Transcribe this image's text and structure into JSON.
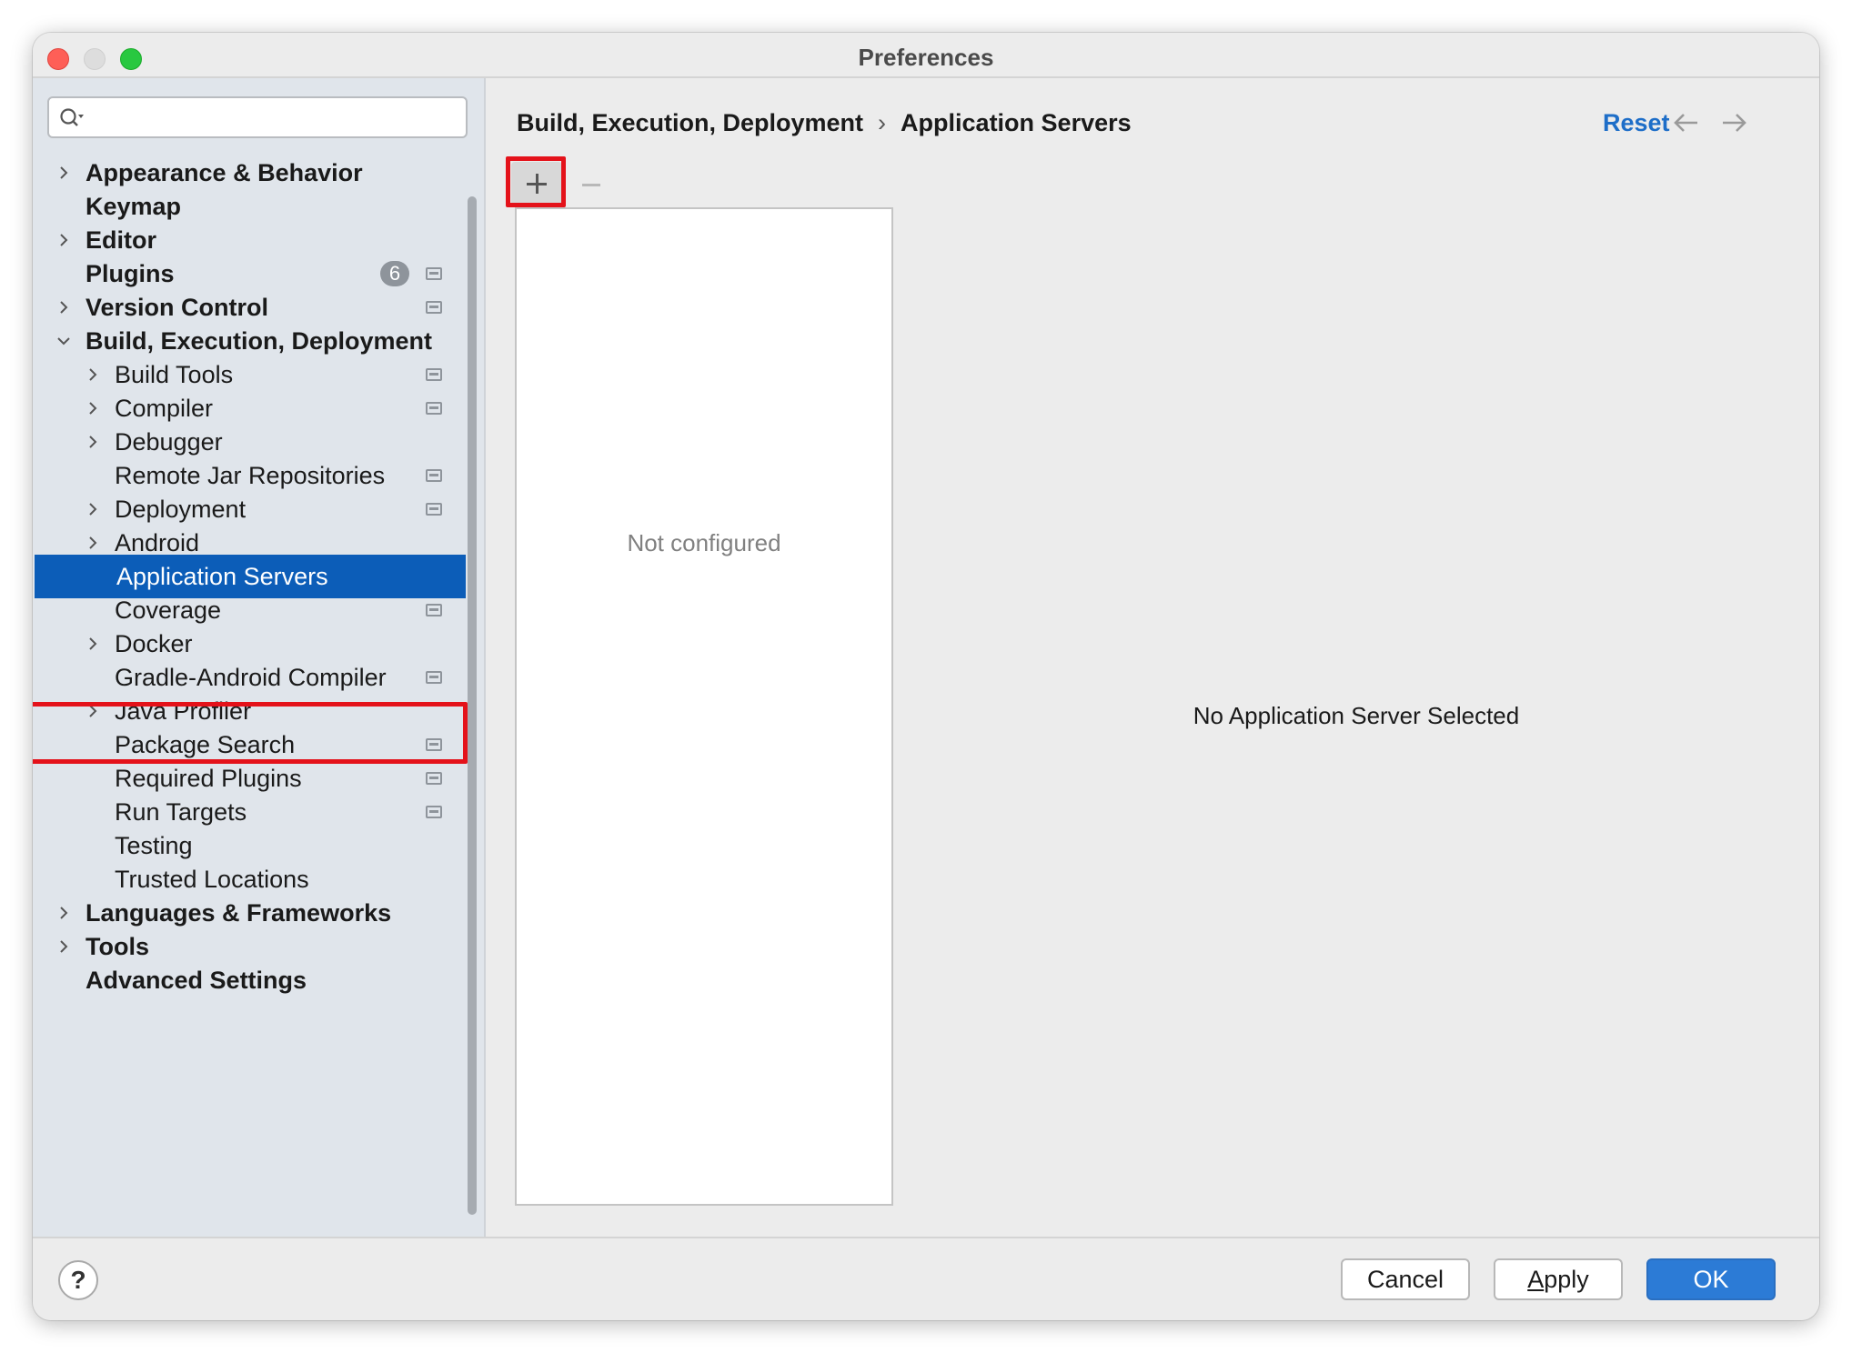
{
  "window": {
    "title": "Preferences"
  },
  "search": {
    "placeholder": "",
    "value": ""
  },
  "sidebar": {
    "items": [
      {
        "label": "Appearance & Behavior",
        "level": 0,
        "expandable": true,
        "expanded": false,
        "project_icon": false
      },
      {
        "label": "Keymap",
        "level": 0,
        "expandable": false,
        "project_icon": false
      },
      {
        "label": "Editor",
        "level": 0,
        "expandable": true,
        "expanded": false,
        "project_icon": false
      },
      {
        "label": "Plugins",
        "level": 0,
        "expandable": false,
        "badge": "6",
        "project_icon": true
      },
      {
        "label": "Version Control",
        "level": 0,
        "expandable": true,
        "expanded": false,
        "project_icon": true
      },
      {
        "label": "Build, Execution, Deployment",
        "level": 0,
        "expandable": true,
        "expanded": true,
        "project_icon": false
      },
      {
        "label": "Build Tools",
        "level": 1,
        "expandable": true,
        "expanded": false,
        "project_icon": true
      },
      {
        "label": "Compiler",
        "level": 1,
        "expandable": true,
        "expanded": false,
        "project_icon": true
      },
      {
        "label": "Debugger",
        "level": 1,
        "expandable": true,
        "expanded": false,
        "project_icon": false
      },
      {
        "label": "Remote Jar Repositories",
        "level": 1,
        "expandable": false,
        "project_icon": true
      },
      {
        "label": "Deployment",
        "level": 1,
        "expandable": true,
        "expanded": false,
        "project_icon": true
      },
      {
        "label": "Android",
        "level": 1,
        "expandable": true,
        "expanded": false,
        "project_icon": false
      },
      {
        "label": "Application Servers",
        "level": 1,
        "expandable": false,
        "selected": true,
        "project_icon": false
      },
      {
        "label": "Coverage",
        "level": 1,
        "expandable": false,
        "project_icon": true
      },
      {
        "label": "Docker",
        "level": 1,
        "expandable": true,
        "expanded": false,
        "project_icon": false
      },
      {
        "label": "Gradle-Android Compiler",
        "level": 1,
        "expandable": false,
        "project_icon": true
      },
      {
        "label": "Java Profiler",
        "level": 1,
        "expandable": true,
        "expanded": false,
        "project_icon": false
      },
      {
        "label": "Package Search",
        "level": 1,
        "expandable": false,
        "project_icon": true
      },
      {
        "label": "Required Plugins",
        "level": 1,
        "expandable": false,
        "project_icon": true
      },
      {
        "label": "Run Targets",
        "level": 1,
        "expandable": false,
        "project_icon": true
      },
      {
        "label": "Testing",
        "level": 1,
        "expandable": false,
        "project_icon": false
      },
      {
        "label": "Trusted Locations",
        "level": 1,
        "expandable": false,
        "project_icon": false
      },
      {
        "label": "Languages & Frameworks",
        "level": 0,
        "expandable": true,
        "expanded": false,
        "project_icon": false
      },
      {
        "label": "Tools",
        "level": 0,
        "expandable": true,
        "expanded": false,
        "project_icon": false
      },
      {
        "label": "Advanced Settings",
        "level": 0,
        "expandable": false,
        "project_icon": false
      }
    ]
  },
  "main": {
    "breadcrumb": {
      "parent": "Build, Execution, Deployment",
      "separator": "›",
      "current": "Application Servers"
    },
    "reset_label": "Reset",
    "server_list": {
      "empty_text": "Not configured"
    },
    "detail": {
      "empty_text": "No Application Server Selected"
    }
  },
  "footer": {
    "help_label": "?",
    "cancel_label": "Cancel",
    "apply_label": "Apply",
    "ok_label": "OK"
  },
  "colors": {
    "accent": "#0c5db8",
    "link": "#1e6ec8",
    "ok_button": "#2c7bd6",
    "annotation_highlight": "#e4121a",
    "sidebar_bg": "#e0e5eb"
  }
}
